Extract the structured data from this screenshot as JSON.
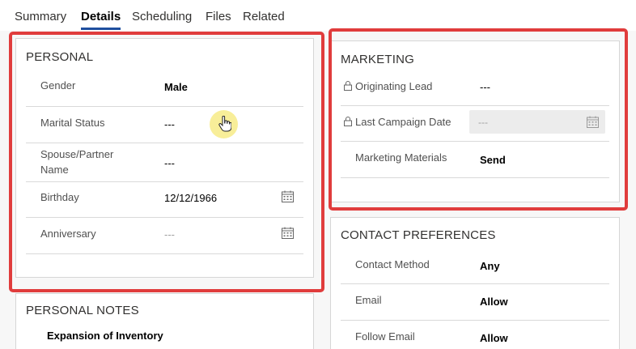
{
  "tabs": [
    {
      "label": "Summary"
    },
    {
      "label": "Details"
    },
    {
      "label": "Scheduling"
    },
    {
      "label": "Files"
    },
    {
      "label": "Related"
    }
  ],
  "personal": {
    "title": "PERSONAL",
    "fields": [
      {
        "label": "Gender",
        "value": "Male"
      },
      {
        "label": "Marital Status",
        "value": "---"
      },
      {
        "label": "Spouse/Partner Name",
        "value": "---"
      },
      {
        "label": "Birthday",
        "value": "12/12/1966"
      },
      {
        "label": "Anniversary",
        "value": "---"
      }
    ]
  },
  "personal_notes": {
    "title": "PERSONAL NOTES",
    "note": "Expansion of Inventory"
  },
  "marketing": {
    "title": "MARKETING",
    "fields": [
      {
        "label": "Originating Lead",
        "value": "---"
      },
      {
        "label": "Last Campaign Date",
        "value": "---"
      },
      {
        "label": "Marketing Materials",
        "value": "Send"
      }
    ]
  },
  "contact_preferences": {
    "title": "CONTACT PREFERENCES",
    "fields": [
      {
        "label": "Contact Method",
        "value": "Any"
      },
      {
        "label": "Email",
        "value": "Allow"
      },
      {
        "label": "Follow Email",
        "value": "Allow"
      }
    ]
  },
  "colors": {
    "highlight": "#e03c3c",
    "active_tab_underline": "#1f4f9e",
    "cursor_glow": "#f7ec8e"
  }
}
